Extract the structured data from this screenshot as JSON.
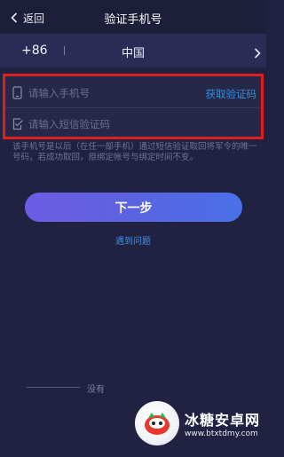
{
  "header": {
    "back_label": "返回",
    "title": "验证手机号"
  },
  "country_row": {
    "code": "+86",
    "country": "中国"
  },
  "form": {
    "phone_placeholder": "请输入手机号",
    "get_code_label": "获取验证码",
    "sms_placeholder": "请输入短信验证码"
  },
  "hint_text": "该手机号是以后（在任一部手机）通过短信验证取回将军令的唯一号码，若成功取回，原绑定帐号与绑定时间不变。",
  "next_button_label": "下一步",
  "problem_link": "遇到问题",
  "bottom_text": "没有",
  "watermark": {
    "title": "冰糖安卓网",
    "url": "www.btxtdmy.com"
  },
  "colors": {
    "background": "#212241",
    "accent_link": "#2f8fe4",
    "highlight_border": "#e01c1c",
    "button_gradient_start": "#6e5ce4",
    "button_gradient_end": "#4a71e8"
  },
  "icons": {
    "back": "chevron-left-icon",
    "country_select": "chevron-right-icon",
    "phone": "phone-icon",
    "sms": "edit-check-icon"
  }
}
